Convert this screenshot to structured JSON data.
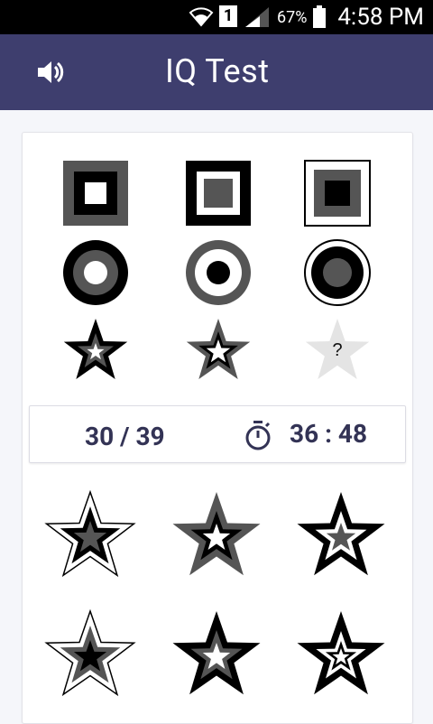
{
  "status_bar": {
    "battery": "67%",
    "sim": "1",
    "clock": "4:58 PM"
  },
  "app_bar": {
    "title": "IQ Test",
    "sound_icon": "speaker-icon"
  },
  "puzzle": {
    "missing_label": "?"
  },
  "score": {
    "progress": "30 / 39",
    "timer": "36 : 48"
  },
  "colors": {
    "app_bar": "#3e3e6e",
    "text_dark": "#333355",
    "gray": "#555555",
    "black": "#000000"
  }
}
